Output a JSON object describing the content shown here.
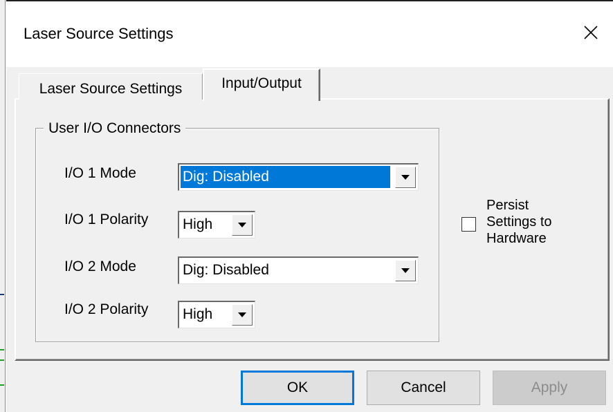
{
  "window": {
    "title": "Laser Source Settings",
    "close_icon": "close-icon"
  },
  "tabs": [
    {
      "label": "Laser Source Settings",
      "active": false
    },
    {
      "label": "Input/Output",
      "active": true
    }
  ],
  "group": {
    "legend": "User I/O Connectors",
    "fields": [
      {
        "label": "I/O 1 Mode",
        "value": "Dig: Disabled",
        "focused": true
      },
      {
        "label": "I/O 1 Polarity",
        "value": "High",
        "focused": false
      },
      {
        "label": "I/O 2 Mode",
        "value": "Dig: Disabled",
        "focused": false
      },
      {
        "label": "I/O 2 Polarity",
        "value": "High",
        "focused": false
      }
    ]
  },
  "persist": {
    "label_lines": [
      "Persist",
      "Settings to",
      "Hardware"
    ],
    "checked": false
  },
  "buttons": {
    "ok": "OK",
    "cancel": "Cancel",
    "apply": "Apply"
  },
  "colors": {
    "selection": "#0078d7",
    "dialog_bg": "#f0f0f0",
    "default_button_border": "#0078d7"
  }
}
